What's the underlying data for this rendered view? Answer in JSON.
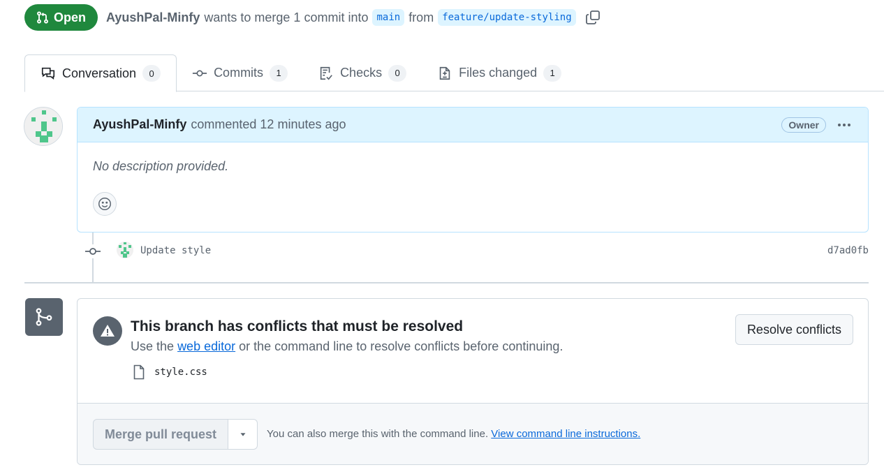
{
  "header": {
    "state_label": "Open",
    "author": "AyushPal-Minfy",
    "wants_text": "wants to merge 1 commit into",
    "base_branch": "main",
    "from_text": "from",
    "head_branch": "feature/update-styling"
  },
  "tabs": [
    {
      "label": "Conversation",
      "count": "0",
      "icon": "comment-discussion-icon"
    },
    {
      "label": "Commits",
      "count": "1",
      "icon": "git-commit-icon"
    },
    {
      "label": "Checks",
      "count": "0",
      "icon": "checklist-icon"
    },
    {
      "label": "Files changed",
      "count": "1",
      "icon": "file-diff-icon"
    }
  ],
  "comment": {
    "author": "AyushPal-Minfy",
    "action": "commented",
    "time": "12 minutes ago",
    "role_badge": "Owner",
    "body": "No description provided."
  },
  "commit": {
    "message": "Update style",
    "sha": "d7ad0fb"
  },
  "merge": {
    "conflict_title": "This branch has conflicts that must be resolved",
    "desc_prefix": "Use the",
    "desc_link": "web editor",
    "desc_suffix": "or the command line to resolve conflicts before continuing.",
    "conflict_file": "style.css",
    "resolve_label": "Resolve conflicts",
    "merge_label": "Merge pull request",
    "hint_text": "You can also merge this with the command line.",
    "hint_link": "View command line instructions."
  },
  "colors": {
    "open_green": "#1f883d",
    "link_blue": "#0969da",
    "avatar_green": "#4fc68b"
  }
}
